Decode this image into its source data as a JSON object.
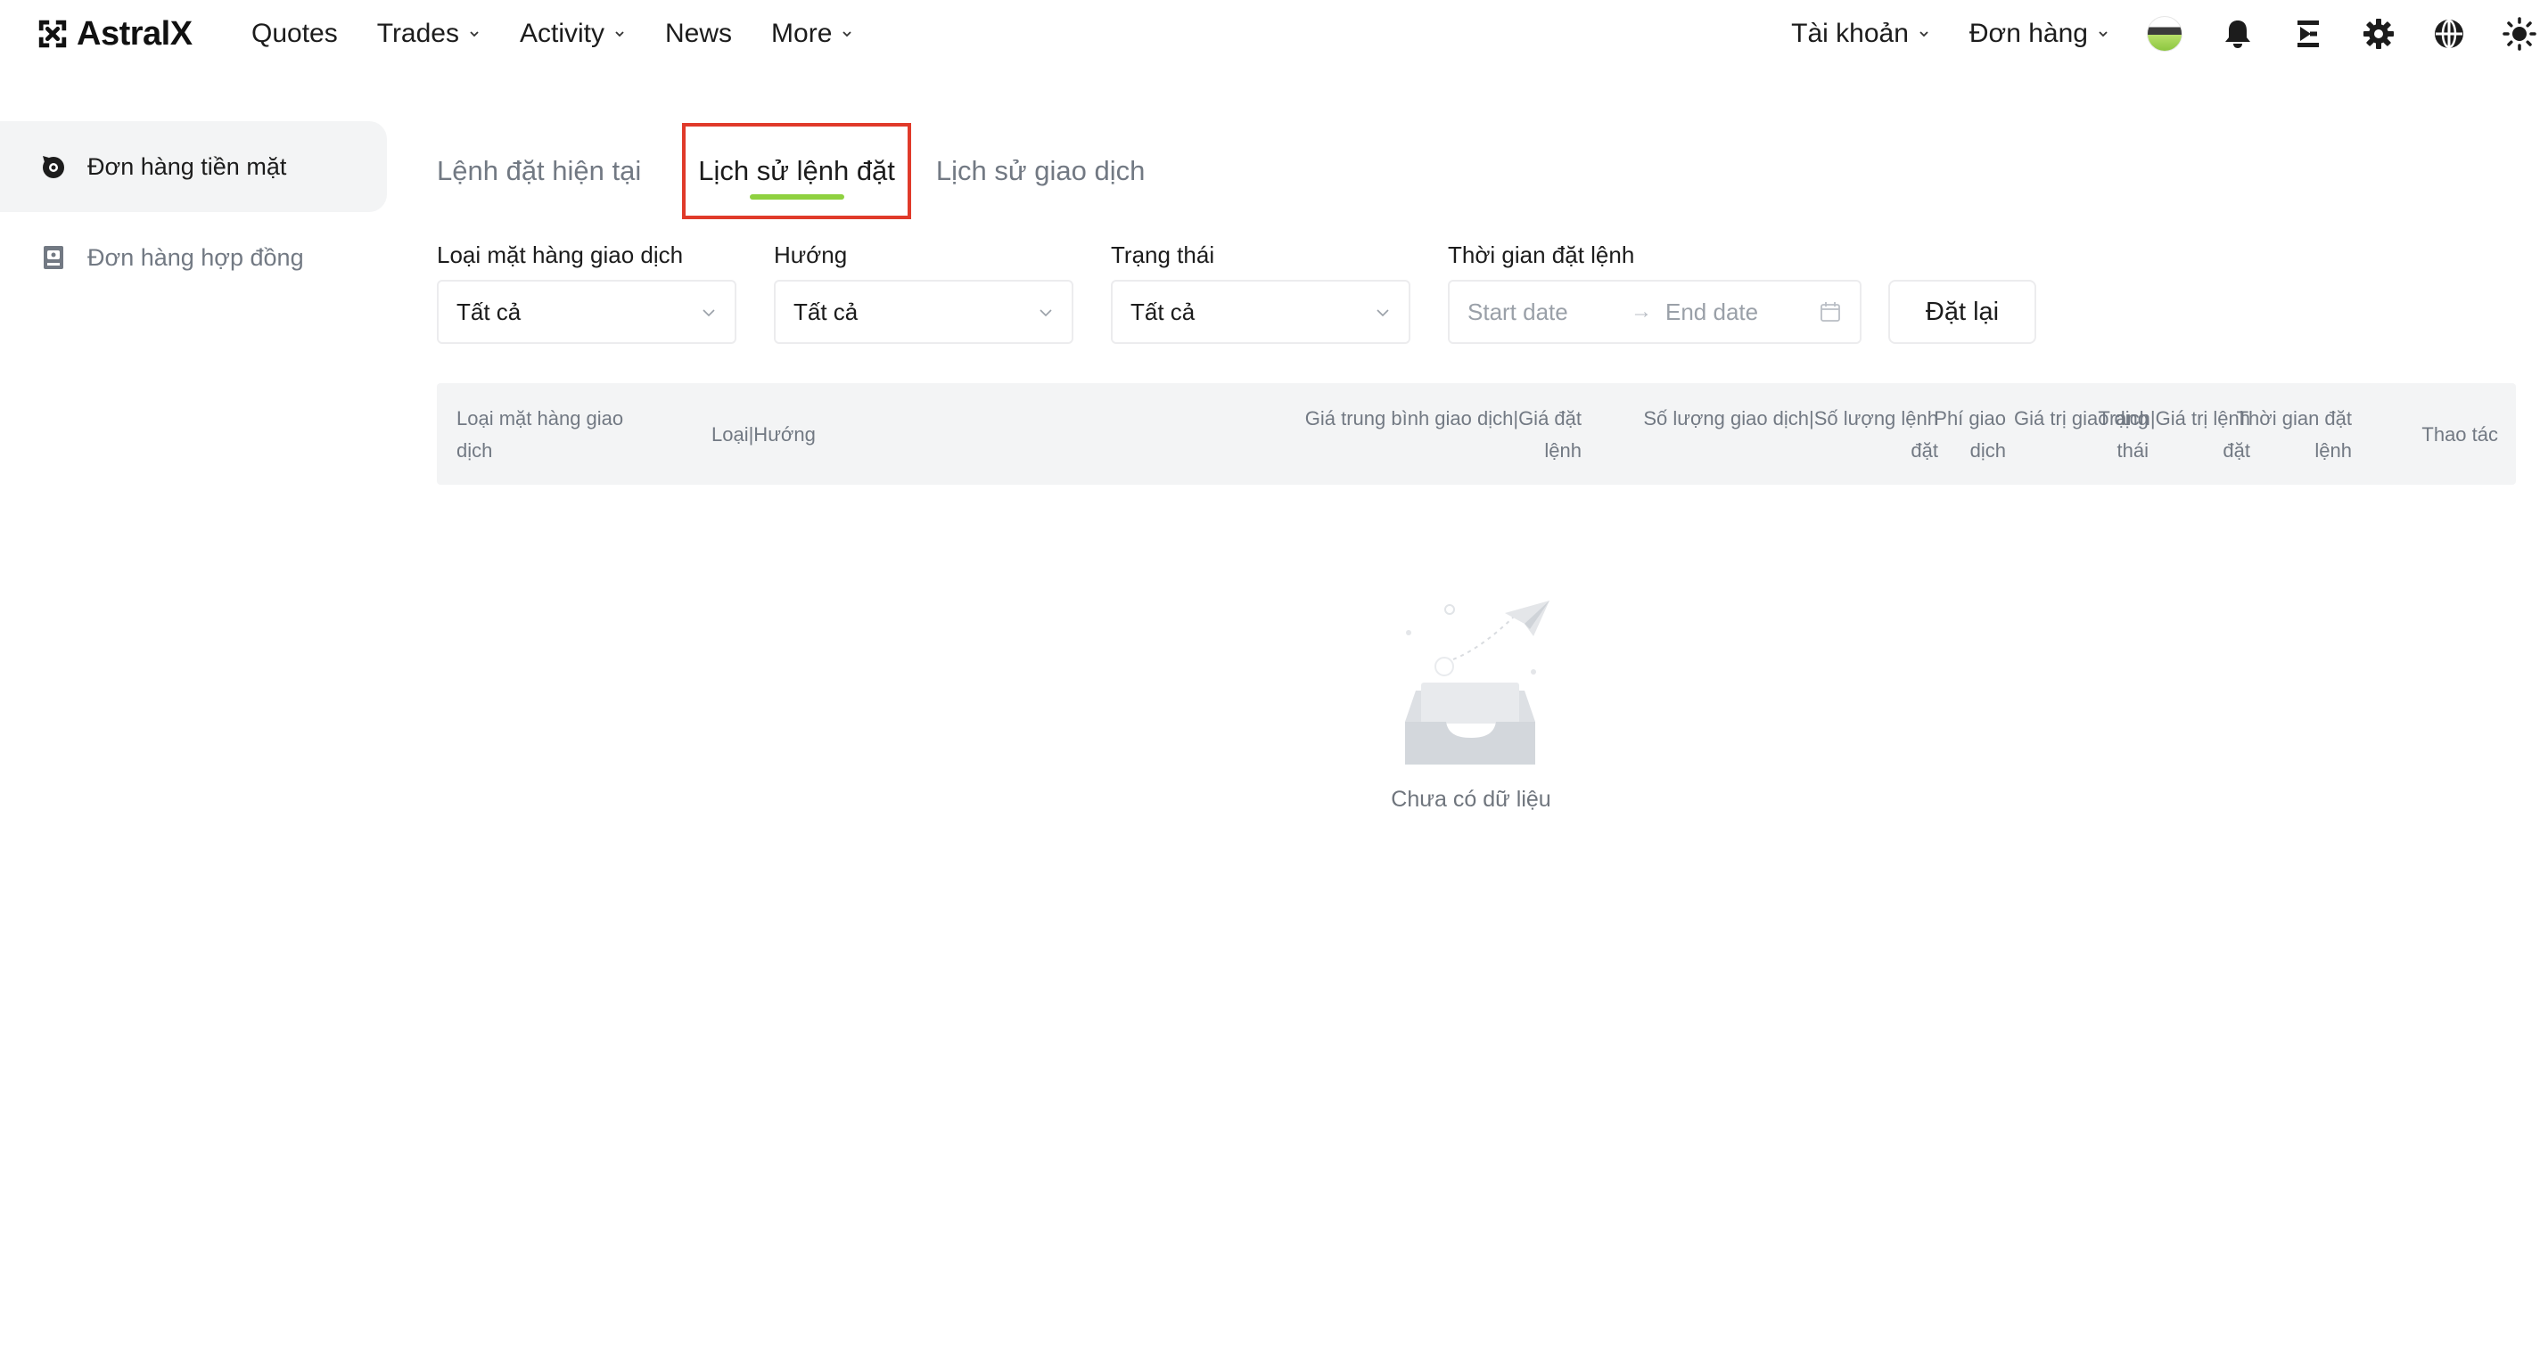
{
  "brand": {
    "name": "AstralX"
  },
  "nav": {
    "left": [
      {
        "label": "Quotes",
        "has_dropdown": false
      },
      {
        "label": "Trades",
        "has_dropdown": true
      },
      {
        "label": "Activity",
        "has_dropdown": true
      },
      {
        "label": "News",
        "has_dropdown": false
      },
      {
        "label": "More",
        "has_dropdown": true
      }
    ],
    "right": {
      "account_label": "Tài khoản",
      "orders_label": "Đơn hàng",
      "icons": [
        "avatar",
        "bell-icon",
        "download-app-icon",
        "gear-icon",
        "globe-icon",
        "theme-sun-icon"
      ]
    }
  },
  "sidebar": {
    "items": [
      {
        "label": "Đơn hàng tiền mặt",
        "icon": "spot-order-icon",
        "active": true
      },
      {
        "label": "Đơn hàng hợp đồng",
        "icon": "contract-order-icon",
        "active": false
      }
    ]
  },
  "tabs": [
    {
      "label": "Lệnh đặt hiện tại",
      "active": false
    },
    {
      "label": "Lịch sử lệnh đặt",
      "active": true
    },
    {
      "label": "Lịch sử giao dịch",
      "active": false
    }
  ],
  "filters": {
    "pair": {
      "label": "Loại mặt hàng giao dịch",
      "value": "Tất cả"
    },
    "direction": {
      "label": "Hướng",
      "value": "Tất cả"
    },
    "status": {
      "label": "Trạng thái",
      "value": "Tất cả"
    },
    "time": {
      "label": "Thời gian đặt lệnh",
      "start_placeholder": "Start date",
      "end_placeholder": "End date",
      "arrow": "→"
    },
    "reset_label": "Đặt lại"
  },
  "table": {
    "columns": [
      {
        "line1": "Loại mặt hàng giao",
        "line2": "dịch",
        "align": "left"
      },
      {
        "line1": "Loại|Hướng",
        "line2": "",
        "align": "left"
      },
      {
        "line1": "Giá trung bình giao dịch|Giá đặt",
        "line2": "lệnh",
        "align": "right"
      },
      {
        "line1": "Số lượng giao dịch|Số lượng lệnh",
        "line2": "đặt",
        "align": "right"
      },
      {
        "line1": "Giá trị giao dịch|Giá trị lệnh",
        "line2": "đặt",
        "align": "right"
      },
      {
        "line1": "Phí giao",
        "line2": "dịch",
        "align": "right"
      },
      {
        "line1": "Trạng",
        "line2": "thái",
        "align": "right"
      },
      {
        "line1": "Thời gian đặt",
        "line2": "lệnh",
        "align": "right"
      },
      {
        "line1": "Thao tác",
        "line2": "",
        "align": "right"
      }
    ],
    "empty_text": "Chưa có dữ liệu"
  },
  "colors": {
    "accent_green": "#8fd140",
    "highlight_red": "#e03a2a",
    "muted_text": "#727983",
    "panel_gray": "#f3f4f5"
  }
}
